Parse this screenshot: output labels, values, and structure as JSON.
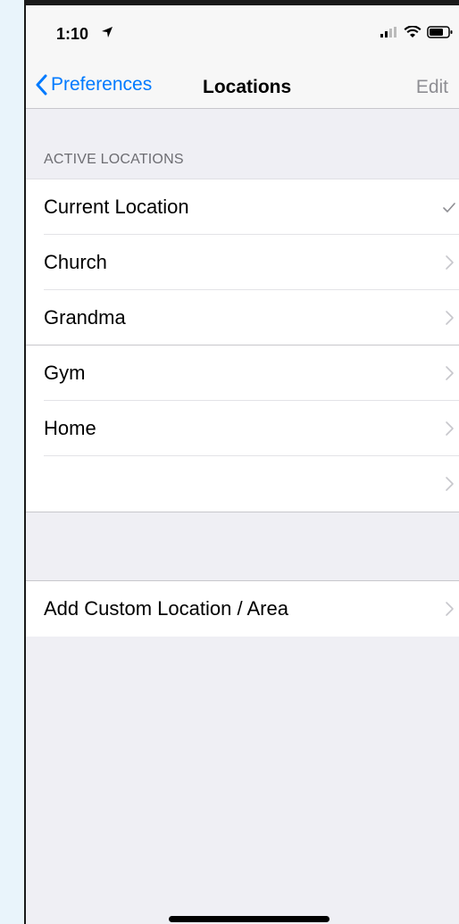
{
  "status_bar": {
    "time": "1:10"
  },
  "nav": {
    "back_label": "Preferences",
    "title": "Locations",
    "edit_label": "Edit"
  },
  "section": {
    "header": "ACTIVE LOCATIONS"
  },
  "locations": [
    {
      "label": "Current Location",
      "accessory": "checkmark-icon"
    },
    {
      "label": "Church",
      "accessory": "chevron-right-icon"
    },
    {
      "label": "Grandma",
      "accessory": "chevron-right-icon"
    },
    {
      "label": "Gym",
      "accessory": "chevron-right-icon"
    },
    {
      "label": "Home",
      "accessory": "chevron-right-icon"
    },
    {
      "label": "",
      "accessory": "chevron-right-icon"
    }
  ],
  "add_custom": {
    "label": "Add Custom Location / Area",
    "accessory": "chevron-right-icon"
  },
  "colors": {
    "accent": "#007aff",
    "background": "#efeff4",
    "chevron": "#c7c7cc"
  }
}
